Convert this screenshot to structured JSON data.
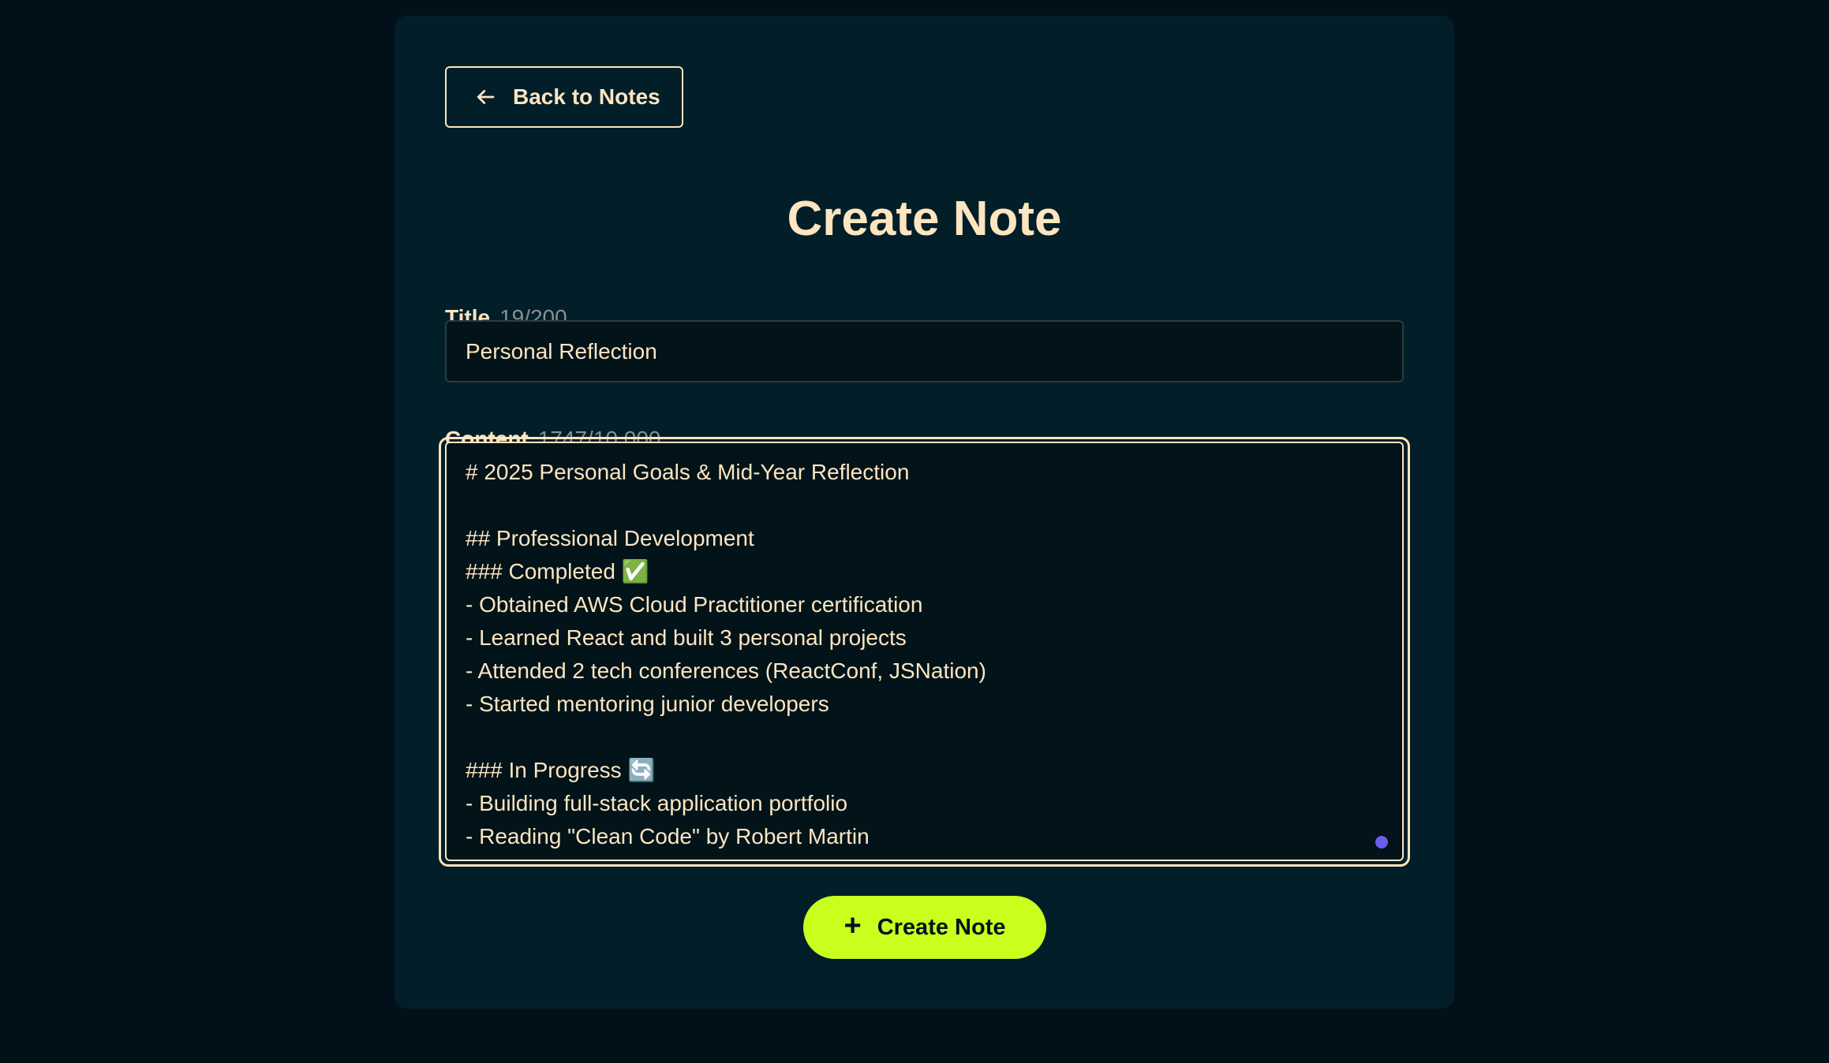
{
  "back_button": {
    "label": "Back to Notes",
    "icon": "arrow-left-icon"
  },
  "heading": "Create Note",
  "title_field": {
    "label": "Title",
    "count": "19/200",
    "value": "Personal Reflection"
  },
  "content_field": {
    "label": "Content",
    "count": "1747/10,000",
    "lines": [
      "# 2025 Personal Goals & Mid-Year Reflection",
      "",
      "## Professional Development",
      "### Completed ✅",
      "- Obtained AWS Cloud Practitioner certification",
      "- Learned React and built 3 personal projects",
      "- Attended 2 tech conferences (ReactConf, JSNation)",
      "- Started mentoring junior developers",
      "",
      "### In Progress 🔄",
      "- Building full-stack application portfolio",
      "- Reading \"Clean Code\" by Robert Martin"
    ]
  },
  "create_button": {
    "label": "Create Note",
    "icon": "plus-icon"
  },
  "colors": {
    "page_bg": "#021119",
    "card_bg": "#021e29",
    "text": "#fde5c0",
    "accent": "#c8ff1c",
    "resize_handle": "#6a5cf0"
  }
}
